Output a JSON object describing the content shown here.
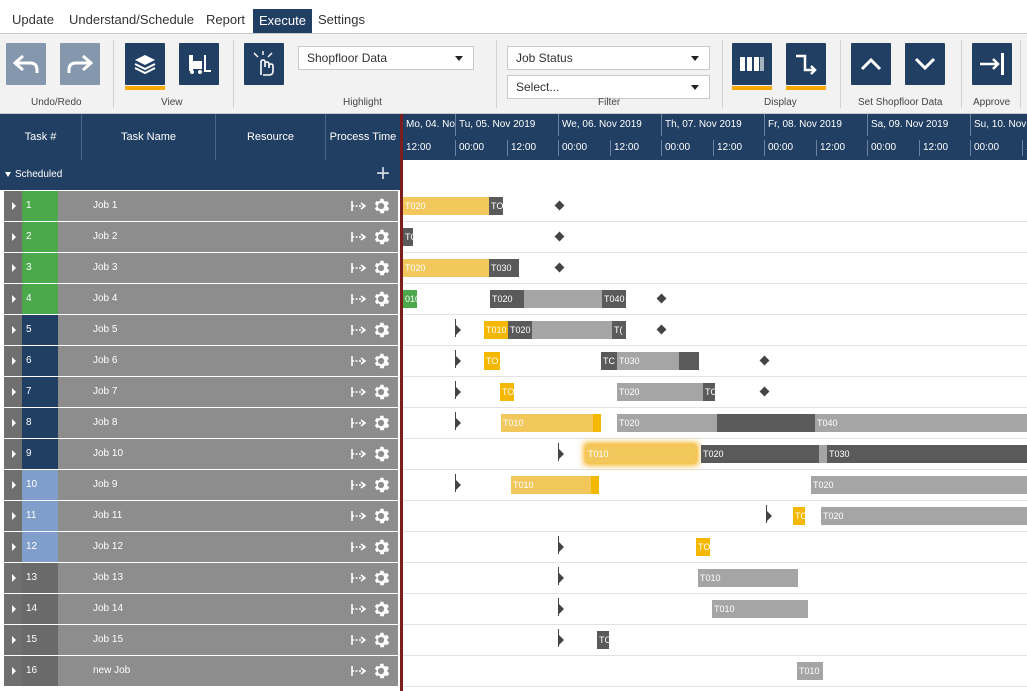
{
  "menu": {
    "items": [
      {
        "label": "Update"
      },
      {
        "label": "Understand/Schedule"
      },
      {
        "label": "Report"
      },
      {
        "label": "Execute",
        "active": true
      },
      {
        "label": "Settings"
      }
    ]
  },
  "ribbon": {
    "groups": {
      "undo_redo": "Undo/Redo",
      "view": "View",
      "highlight": "Highlight",
      "filter": "Filter",
      "display": "Display",
      "set_shopfloor": "Set Shopfloor Data",
      "approve": "Approve"
    },
    "highlight_select": "Shopfloor Data",
    "filter_select": "Job Status",
    "filter_placeholder": "Select...",
    "accent": "#f5a800",
    "primary": "#213f63"
  },
  "grid": {
    "columns": [
      "Task #",
      "Task Name",
      "Resource",
      "Process Time"
    ],
    "section": "Scheduled",
    "rows": [
      {
        "num": "1",
        "name": "Job 1",
        "color": "#4ba84b"
      },
      {
        "num": "2",
        "name": "Job 2",
        "color": "#4ba84b"
      },
      {
        "num": "3",
        "name": "Job 3",
        "color": "#4ba84b"
      },
      {
        "num": "4",
        "name": "Job 4",
        "color": "#4ba84b"
      },
      {
        "num": "5",
        "name": "Job 5",
        "color": "#213f63"
      },
      {
        "num": "6",
        "name": "Job 6",
        "color": "#213f63"
      },
      {
        "num": "7",
        "name": "Job 7",
        "color": "#213f63"
      },
      {
        "num": "8",
        "name": "Job 8",
        "color": "#213f63"
      },
      {
        "num": "9",
        "name": "Job 10",
        "color": "#213f63"
      },
      {
        "num": "10",
        "name": "Job 9",
        "color": "#7f9fca"
      },
      {
        "num": "11",
        "name": "Job 11",
        "color": "#7f9fca"
      },
      {
        "num": "12",
        "name": "Job 12",
        "color": "#7f9fca"
      },
      {
        "num": "13",
        "name": "Job 13",
        "color": "#6a6a6a"
      },
      {
        "num": "14",
        "name": "Job 14",
        "color": "#6a6a6a"
      },
      {
        "num": "15",
        "name": "Job 15",
        "color": "#6a6a6a"
      },
      {
        "num": "16",
        "name": "new Job",
        "color": "#6a6a6a"
      }
    ]
  },
  "timeline": {
    "days": [
      "Mo, 04. No",
      "Tu, 05. Nov 2019",
      "We, 06. Nov 2019",
      "Th, 07. Nov 2019",
      "Fr, 08. Nov 2019",
      "Sa, 09. Nov 2019",
      "Su, 10. Nov 2"
    ],
    "hours": [
      "12:00",
      "00:00",
      "12:00",
      "00:00",
      "12:00",
      "00:00",
      "12:00",
      "00:00",
      "12:00",
      "00:00",
      "12:00",
      "00:00",
      "1"
    ]
  },
  "gantt": {
    "rows": [
      {
        "bars": [
          {
            "label": "T020",
            "style": "yellow"
          },
          {
            "label": "TO",
            "style": "dark"
          }
        ],
        "diamond": true
      },
      {
        "bars": [
          {
            "label": "TO",
            "style": "dark"
          }
        ],
        "diamond": true
      },
      {
        "bars": [
          {
            "label": "T020",
            "style": "yellow"
          },
          {
            "label": "T030",
            "style": "dark"
          }
        ],
        "diamond": true
      },
      {
        "bars": [
          {
            "label": "010",
            "style": "green"
          },
          {
            "label": "T020",
            "style": "dark"
          },
          {
            "label": "",
            "style": "gray"
          },
          {
            "label": "T040",
            "style": "dark"
          }
        ],
        "diamond": true
      },
      {
        "bars": [
          {
            "label": "T010",
            "style": "yellow-d"
          },
          {
            "label": "T020",
            "style": "dark"
          },
          {
            "label": "",
            "style": "gray"
          },
          {
            "label": "T(",
            "style": "dark"
          }
        ],
        "diamond": true
      },
      {
        "bars": [
          {
            "label": "TO",
            "style": "yellow-d"
          },
          {
            "label": "TC",
            "style": "dark"
          },
          {
            "label": "T030",
            "style": "gray"
          },
          {
            "label": "",
            "style": "dark"
          }
        ],
        "diamond": true
      },
      {
        "bars": [
          {
            "label": "TO",
            "style": "yellow-d"
          },
          {
            "label": "T020",
            "style": "gray"
          },
          {
            "label": "TO",
            "style": "dark"
          }
        ],
        "diamond": true
      },
      {
        "bars": [
          {
            "label": "T010",
            "style": "yellow"
          },
          {
            "label": "",
            "style": "yellow-d"
          },
          {
            "label": "T020",
            "style": "gray"
          },
          {
            "label": "",
            "style": "dark"
          },
          {
            "label": "T040",
            "style": "gray"
          }
        ],
        "diamond": false
      },
      {
        "bars": [
          {
            "label": "T010",
            "style": "yellow"
          },
          {
            "label": "T020",
            "style": "dark"
          },
          {
            "label": "",
            "style": "gray"
          },
          {
            "label": "T030",
            "style": "dark"
          },
          {
            "label": "",
            "style": "gray"
          }
        ],
        "diamond": false
      },
      {
        "bars": [
          {
            "label": "T010",
            "style": "yellow"
          },
          {
            "label": "",
            "style": "yellow-d"
          },
          {
            "label": "T020",
            "style": "gray"
          }
        ],
        "diamond": false
      },
      {
        "bars": [
          {
            "label": "TO",
            "style": "yellow-d"
          },
          {
            "label": "T020",
            "style": "gray"
          }
        ],
        "diamond": false
      },
      {
        "bars": [
          {
            "label": "TO",
            "style": "yellow-d"
          }
        ],
        "diamond": false
      },
      {
        "bars": [
          {
            "label": "T010",
            "style": "gray"
          }
        ],
        "diamond": false
      },
      {
        "bars": [
          {
            "label": "T010",
            "style": "gray"
          }
        ],
        "diamond": false
      },
      {
        "bars": [
          {
            "label": "TC",
            "style": "dark"
          }
        ],
        "diamond": false
      },
      {
        "bars": [
          {
            "label": "T010",
            "style": "gray"
          }
        ],
        "diamond": false
      }
    ]
  }
}
